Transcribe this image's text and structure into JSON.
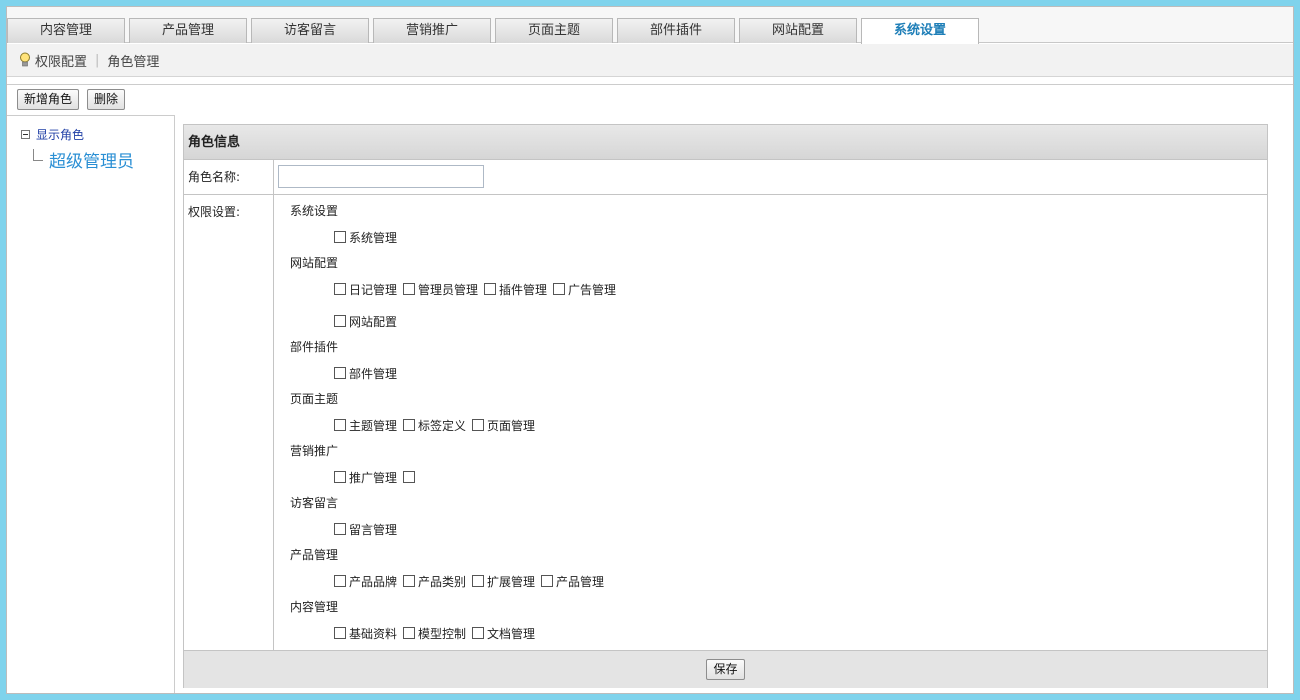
{
  "tabs": [
    "内容管理",
    "产品管理",
    "访客留言",
    "营销推广",
    "页面主题",
    "部件插件",
    "网站配置",
    "系统设置"
  ],
  "active_tab": "系统设置",
  "breadcrumb": [
    "权限配置",
    "角色管理"
  ],
  "toolbar": {
    "add_role": "新增角色",
    "delete": "删除"
  },
  "tree": {
    "root": "显示角色",
    "children": [
      "超级管理员"
    ]
  },
  "panel": {
    "title": "角色信息",
    "name_label": "角色名称:",
    "name_value": "",
    "perm_label": "权限设置:",
    "save_label": "保存"
  },
  "permissions": [
    {
      "group": "系统设置",
      "items": [
        "系统管理"
      ]
    },
    {
      "group": "网站配置",
      "items": [
        "日记管理",
        "管理员管理",
        "插件管理",
        "广告管理",
        "网站配置"
      ]
    },
    {
      "group": "部件插件",
      "items": [
        "部件管理"
      ]
    },
    {
      "group": "页面主题",
      "items": [
        "主题管理",
        "标签定义",
        "页面管理"
      ]
    },
    {
      "group": "营销推广",
      "items": [
        "推广管理",
        ""
      ]
    },
    {
      "group": "访客留言",
      "items": [
        "留言管理"
      ]
    },
    {
      "group": "产品管理",
      "items": [
        "产品品牌",
        "产品类别",
        "扩展管理",
        "产品管理"
      ]
    },
    {
      "group": "内容管理",
      "items": [
        "基础资料",
        "模型控制",
        "文档管理"
      ]
    }
  ],
  "colors": {
    "accent": "#1f7fb8",
    "tree_child": "#2a8fd4",
    "page_bg": "#7fd3ec"
  }
}
